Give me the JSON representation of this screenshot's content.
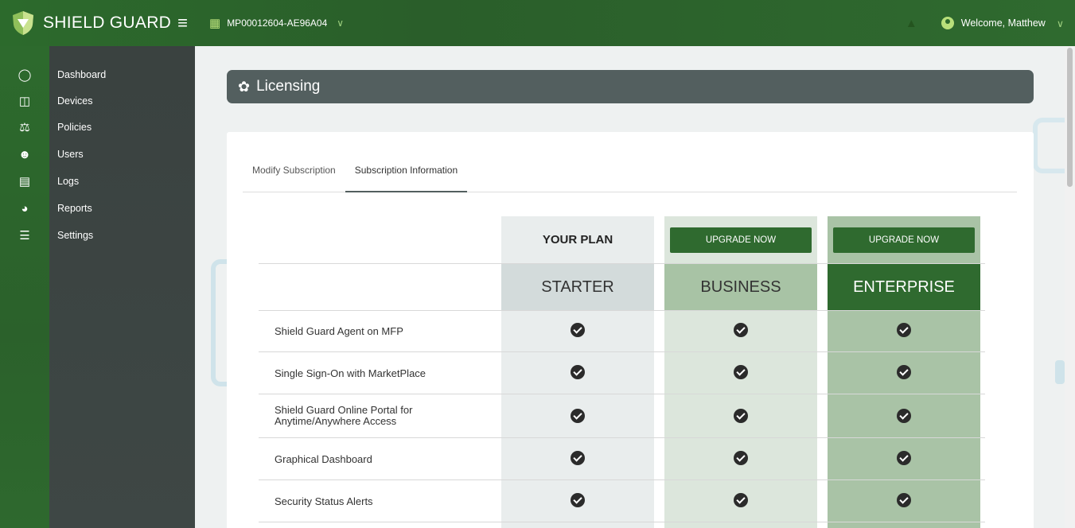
{
  "app": {
    "title": "SHIELD GUARD"
  },
  "topbar": {
    "device_id": "MP00012604-AE96A04",
    "welcome": "Welcome, Matthew"
  },
  "sidebar": {
    "items": [
      {
        "label": "Dashboard",
        "icon": "dashboard-icon"
      },
      {
        "label": "Devices",
        "icon": "devices-icon"
      },
      {
        "label": "Policies",
        "icon": "policies-icon"
      },
      {
        "label": "Users",
        "icon": "users-icon"
      },
      {
        "label": "Logs",
        "icon": "logs-icon"
      },
      {
        "label": "Reports",
        "icon": "reports-icon"
      },
      {
        "label": "Settings",
        "icon": "settings-icon"
      }
    ]
  },
  "page": {
    "title": "Licensing"
  },
  "tabs": [
    {
      "label": "Modify Subscription"
    },
    {
      "label": "Subscription Information",
      "active": true
    }
  ],
  "plans": {
    "your_plan_label": "YOUR PLAN",
    "upgrade_label": "UPGRADE NOW",
    "names": [
      "STARTER",
      "BUSINESS",
      "ENTERPRISE"
    ]
  },
  "features": [
    "Shield Guard Agent on MFP",
    "Single Sign-On with MarketPlace",
    "Shield Guard Online Portal for Anytime/Anywhere Access",
    "Graphical Dashboard",
    "Security Status Alerts"
  ],
  "colors": {
    "brand_green": "#2f6a2f",
    "header_bar": "#535f5f",
    "starter_col": "#e9eded",
    "business_col": "#dce6dc",
    "enterprise_col": "#a9c3a6"
  }
}
